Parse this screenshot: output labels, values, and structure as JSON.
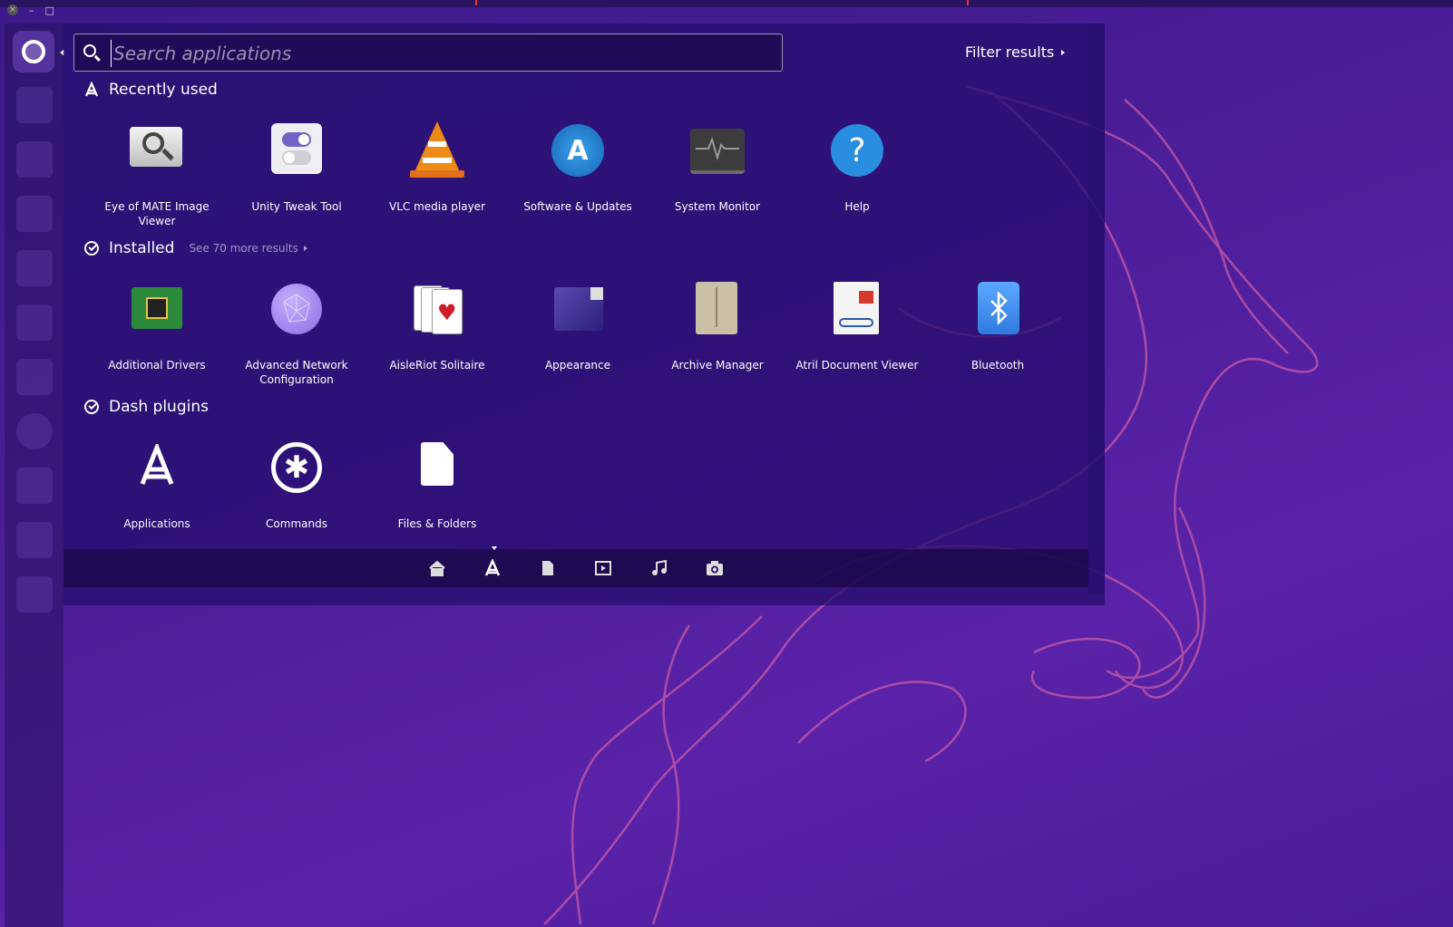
{
  "window_controls": {
    "close": "×",
    "minimize": "–",
    "maximize": "□"
  },
  "search": {
    "value": "",
    "placeholder": "Search applications"
  },
  "filter": {
    "label": "Filter results"
  },
  "sections": {
    "recent": {
      "title": "Recently used"
    },
    "installed": {
      "title": "Installed",
      "see_more": "See 70 more results"
    },
    "plugins": {
      "title": "Dash plugins"
    }
  },
  "recent_apps": [
    {
      "label": "Eye of MATE Image Viewer",
      "icon": "eye-of-mate-icon"
    },
    {
      "label": "Unity Tweak Tool",
      "icon": "unity-tweak-icon"
    },
    {
      "label": "VLC media player",
      "icon": "vlc-icon"
    },
    {
      "label": "Software & Updates",
      "icon": "software-updates-icon"
    },
    {
      "label": "System Monitor",
      "icon": "system-monitor-icon"
    },
    {
      "label": "Help",
      "icon": "help-icon"
    }
  ],
  "installed_apps": [
    {
      "label": "Additional Drivers",
      "icon": "additional-drivers-icon"
    },
    {
      "label": "Advanced Network Configuration",
      "icon": "network-config-icon"
    },
    {
      "label": "AisleRiot Solitaire",
      "icon": "solitaire-icon"
    },
    {
      "label": "Appearance",
      "icon": "appearance-icon"
    },
    {
      "label": "Archive Manager",
      "icon": "archive-manager-icon"
    },
    {
      "label": "Atril Document Viewer",
      "icon": "atril-icon"
    },
    {
      "label": "Bluetooth",
      "icon": "bluetooth-icon"
    }
  ],
  "plugin_apps": [
    {
      "label": "Applications",
      "icon": "applications-icon"
    },
    {
      "label": "Commands",
      "icon": "commands-icon"
    },
    {
      "label": "Files & Folders",
      "icon": "files-folders-icon"
    }
  ],
  "lenses": [
    "home-lens-icon",
    "applications-lens-icon",
    "files-lens-icon",
    "video-lens-icon",
    "music-lens-icon",
    "photo-lens-icon"
  ],
  "active_lens": "applications-lens-icon",
  "colors": {
    "wallpaper": "#4a1d96",
    "dash_overlay": "#260e6e",
    "accent_line": "#c85aa8"
  }
}
